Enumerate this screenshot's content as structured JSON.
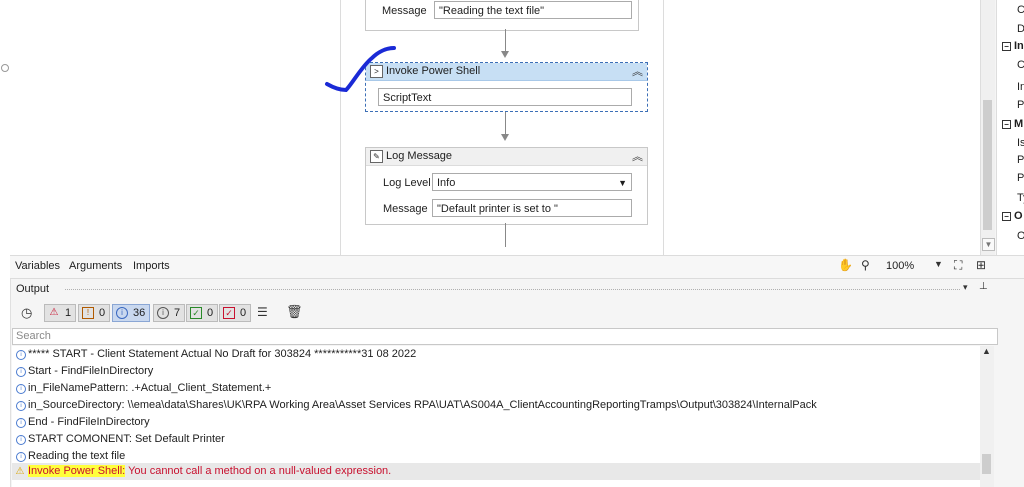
{
  "designer": {
    "activity1": {
      "message_label": "Message",
      "message_value": "\"Reading the text file\""
    },
    "invoke": {
      "title": "Invoke Power Shell",
      "script_value": "ScriptText"
    },
    "log": {
      "title": "Log Message",
      "level_label": "Log Level",
      "level_value": "Info",
      "message_label": "Message",
      "message_value": "\"Default printer is set to \""
    }
  },
  "properties_panel": {
    "rows": [
      {
        "text": "C",
        "section": false
      },
      {
        "text": "D",
        "section": false
      },
      {
        "text": "In",
        "section": true
      },
      {
        "text": "C",
        "section": false
      },
      {
        "text": "In",
        "section": false
      },
      {
        "text": "Pa",
        "section": false
      },
      {
        "text": "M",
        "section": true
      },
      {
        "text": "Is",
        "section": false
      },
      {
        "text": "Pa",
        "section": false
      },
      {
        "text": "Pr",
        "section": false
      },
      {
        "text": "Ty",
        "section": false
      },
      {
        "text": "O",
        "section": true
      },
      {
        "text": "O",
        "section": false
      }
    ]
  },
  "tabs": {
    "variables": "Variables",
    "arguments": "Arguments",
    "imports": "Imports",
    "zoom": "100%"
  },
  "output": {
    "title": "Output",
    "counts": {
      "errors": "1",
      "warnings": "0",
      "info": "36",
      "trace": "7",
      "verbose": "0",
      "fatal": "0"
    },
    "search_placeholder": "Search",
    "rows": [
      "***** START -  Client Statement Actual No Draft for 303824 ***********31 08 2022",
      "Start - FindFileInDirectory",
      "in_FileNamePattern: .+Actual_Client_Statement.+",
      "in_SourceDirectory: \\\\emea\\data\\Shares\\UK\\RPA Working Area\\Asset Services RPA\\UAT\\AS004A_ClientAccountingReportingTramps\\Output\\303824\\InternalPack",
      "End - FindFileInDirectory",
      "START COMONENT: Set Default Printer",
      "Reading the text file"
    ],
    "error_source": "Invoke Power Shell:",
    "error_message": " You cannot call a method on a null-valued expression."
  },
  "colors": {
    "selection": "#c7dff4",
    "error": "#c8102e",
    "highlight": "#ffff3c",
    "annotation": "#1a2ad6"
  }
}
